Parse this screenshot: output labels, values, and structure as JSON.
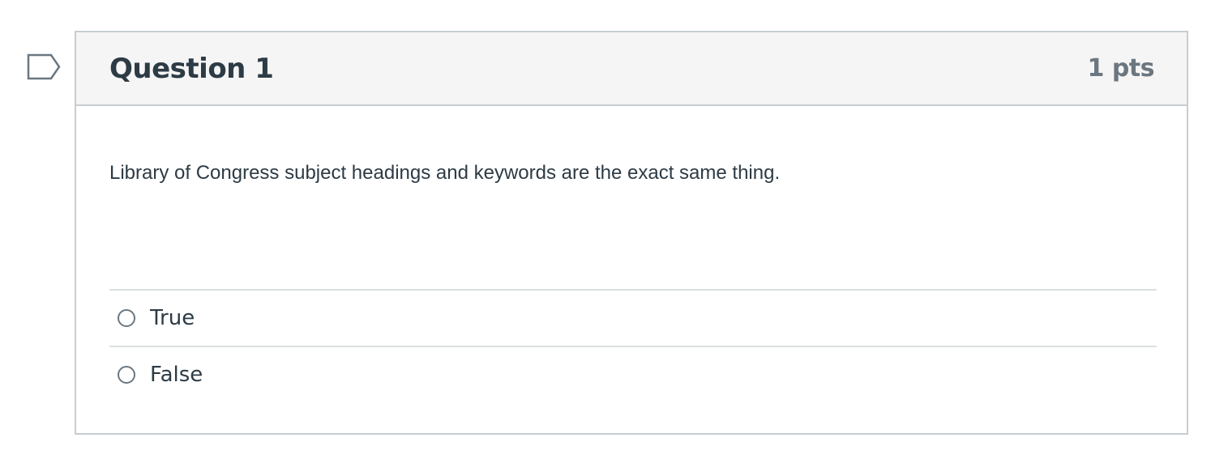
{
  "question": {
    "title": "Question 1",
    "points": "1 pts",
    "text": "Library of Congress subject headings and keywords are the exact same thing.",
    "flag_icon": "bookmark-flag-icon",
    "answers": [
      {
        "label": "True",
        "selected": false
      },
      {
        "label": "False",
        "selected": false
      }
    ]
  },
  "colors": {
    "header_bg": "#f5f5f5",
    "border": "#c7cdd1",
    "text": "#2d3b45",
    "muted": "#6b7780"
  }
}
